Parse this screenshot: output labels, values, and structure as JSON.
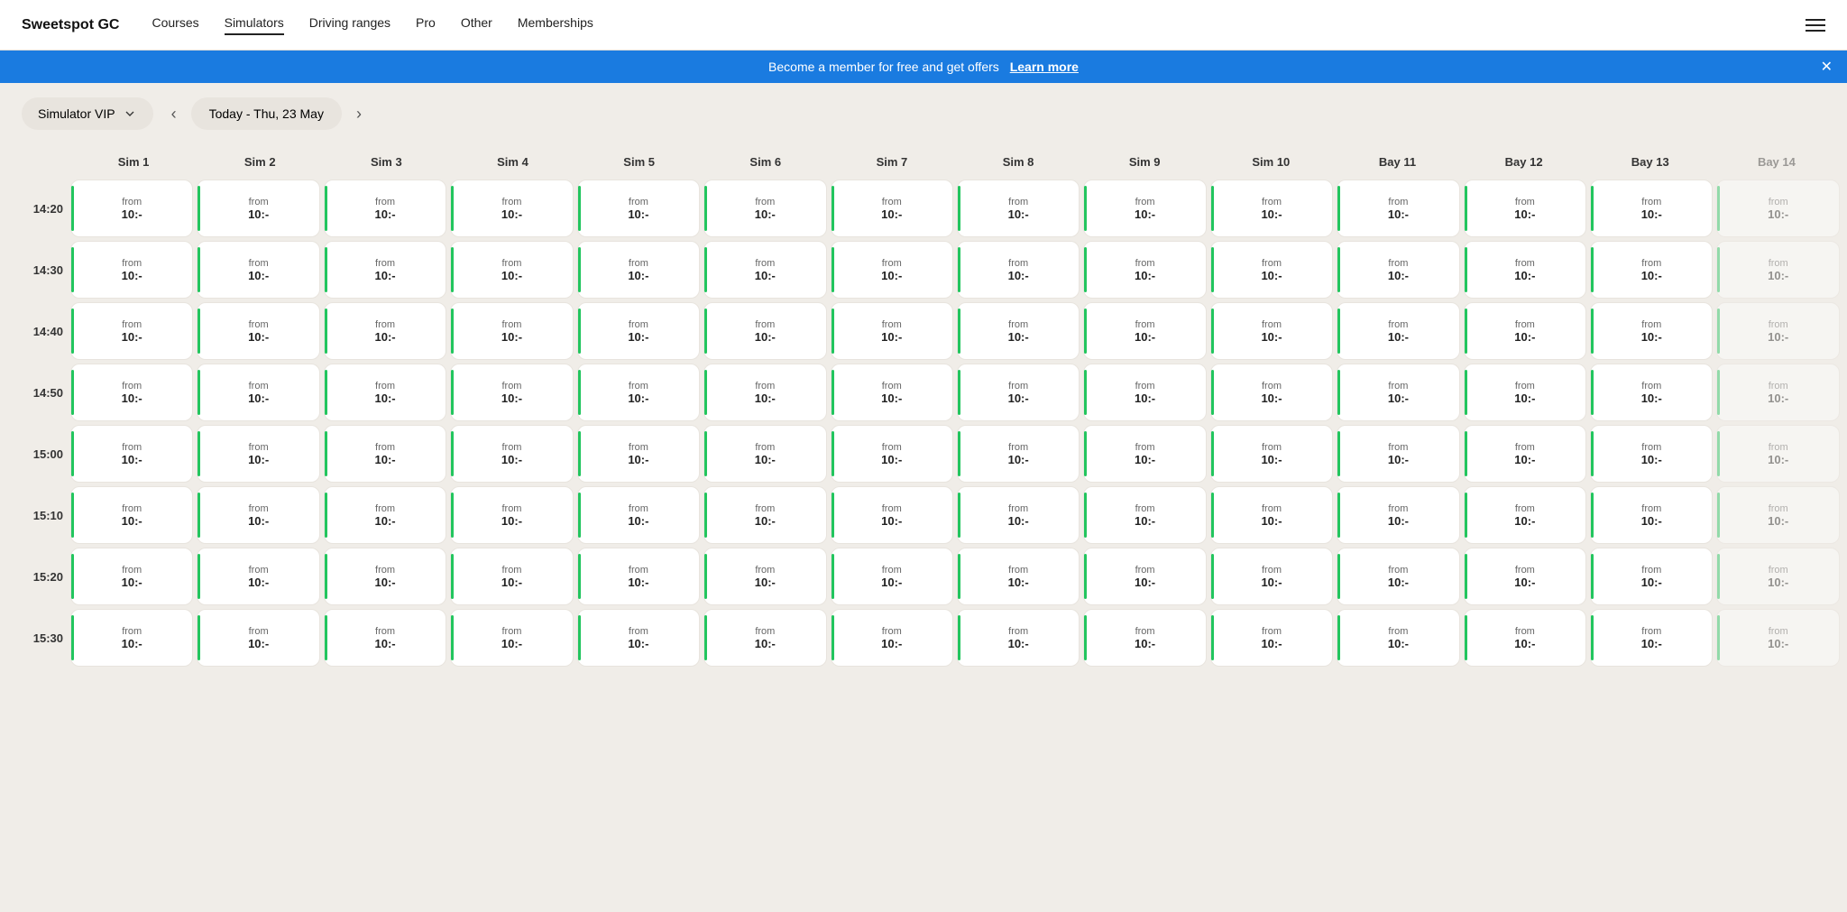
{
  "brand": "Sweetspot GC",
  "nav": {
    "links": [
      "Courses",
      "Simulators",
      "Driving ranges",
      "Pro",
      "Other",
      "Memberships"
    ],
    "active": "Simulators"
  },
  "banner": {
    "text": "Become a member for free and get offers",
    "link_label": "Learn more"
  },
  "controls": {
    "dropdown_label": "Simulator VIP",
    "date_label": "Today - Thu, 23 May"
  },
  "columns": [
    "Sim 1",
    "Sim 2",
    "Sim 3",
    "Sim 4",
    "Sim 5",
    "Sim 6",
    "Sim 7",
    "Sim 8",
    "Sim 9",
    "Sim 10",
    "Bay 11",
    "Bay 12",
    "Bay 13",
    "Bay 14"
  ],
  "times": [
    "14:20",
    "14:30",
    "14:40",
    "14:50",
    "15:00",
    "15:10",
    "15:20",
    "15:30"
  ],
  "cell": {
    "from_label": "from",
    "price": "10:-"
  }
}
